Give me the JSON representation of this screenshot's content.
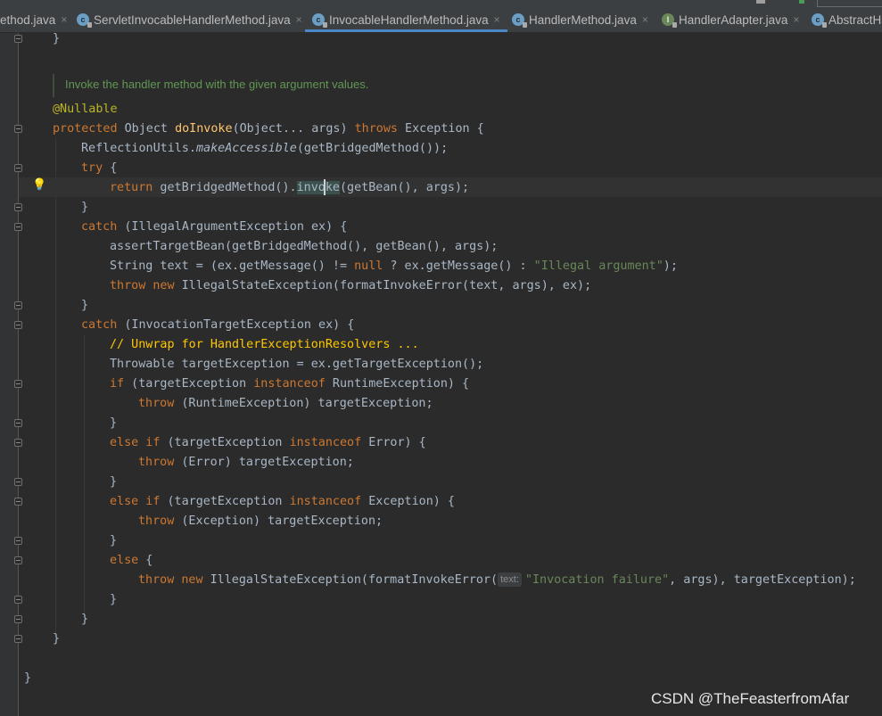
{
  "tabs": [
    {
      "label": "ethod.java",
      "icon": "class-icon",
      "active": false
    },
    {
      "label": "ServletInvocableHandlerMethod.java",
      "icon": "class-icon",
      "active": false
    },
    {
      "label": "InvocableHandlerMethod.java",
      "icon": "class-icon",
      "active": true
    },
    {
      "label": "HandlerMethod.java",
      "icon": "class-icon",
      "active": false
    },
    {
      "label": "HandlerAdapter.java",
      "icon": "interface-icon",
      "active": false
    },
    {
      "label": "AbstractHa",
      "icon": "abstract-class-icon",
      "active": false
    }
  ],
  "tab_close_glyph": "×",
  "doc_comment": "Invoke the handler method with the given argument values.",
  "code": {
    "l1": "}",
    "annotation": "@Nullable",
    "sig_protected": "protected",
    "sig_object": " Object ",
    "sig_name": "doInvoke",
    "sig_params": "(Object... args) ",
    "sig_throws": "throws",
    "sig_tail": " Exception {",
    "l4_a": "ReflectionUtils.",
    "l4_b": "makeAccessible",
    "l4_c": "(getBridgedMethod());",
    "l5_try": "try",
    "l5_b": " {",
    "l6_return": "return",
    "l6_b": " getBridgedMethod().",
    "l6_word": "invoke",
    "l6_c": "(getBean(), args);",
    "l7": "}",
    "l8_catch": "catch",
    "l8_b": " (IllegalArgumentException ex) {",
    "l9": "assertTargetBean(getBridgedMethod(), getBean(), args);",
    "l10_a": "String text = (ex.getMessage() != ",
    "l10_null": "null",
    "l10_b": " ? ex.getMessage() : ",
    "l10_str": "\"Illegal argument\"",
    "l10_c": ");",
    "l11_throw": "throw",
    "l11_new": "new",
    "l11_b": " IllegalStateException(formatInvokeError(text, args), ex);",
    "l12": "}",
    "l13_catch": "catch",
    "l13_b": " (InvocationTargetException ex) {",
    "l14_comment": "// Unwrap for HandlerExceptionResolvers ...",
    "l15": "Throwable targetException = ex.getTargetException();",
    "l16_if": "if",
    "l16_b": " (targetException ",
    "l16_inst": "instanceof",
    "l16_c": " RuntimeException) {",
    "l17_throw": "throw",
    "l17_b": " (RuntimeException) targetException;",
    "l18": "}",
    "l19_else": "else if",
    "l19_b": " (targetException ",
    "l19_inst": "instanceof",
    "l19_c": " Error) {",
    "l20_throw": "throw",
    "l20_b": " (Error) targetException;",
    "l21": "}",
    "l22_else": "else if",
    "l22_b": " (targetException ",
    "l22_inst": "instanceof",
    "l22_c": " Exception) {",
    "l23_throw": "throw",
    "l23_b": " (Exception) targetException;",
    "l24": "}",
    "l25_else": "else",
    "l25_b": " {",
    "l26_throw": "throw",
    "l26_new": "new",
    "l26_b": " IllegalStateException(formatInvokeError(",
    "l26_hint": "text:",
    "l26_str": "\"Invocation failure\"",
    "l26_c": ", args), targetException);",
    "l27": "}",
    "l28": "}",
    "l29": "}",
    "l30": "}"
  },
  "watermark": "CSDN @TheFeasterfromAfar",
  "colors": {
    "background": "#2b2b2b",
    "keyword": "#cc7832",
    "method_decl": "#ffc66d",
    "annotation": "#bbb529",
    "string": "#6a8759",
    "doc_comment": "#629755",
    "todo_comment": "#ffc700",
    "active_tab_underline": "#4a88c7"
  }
}
